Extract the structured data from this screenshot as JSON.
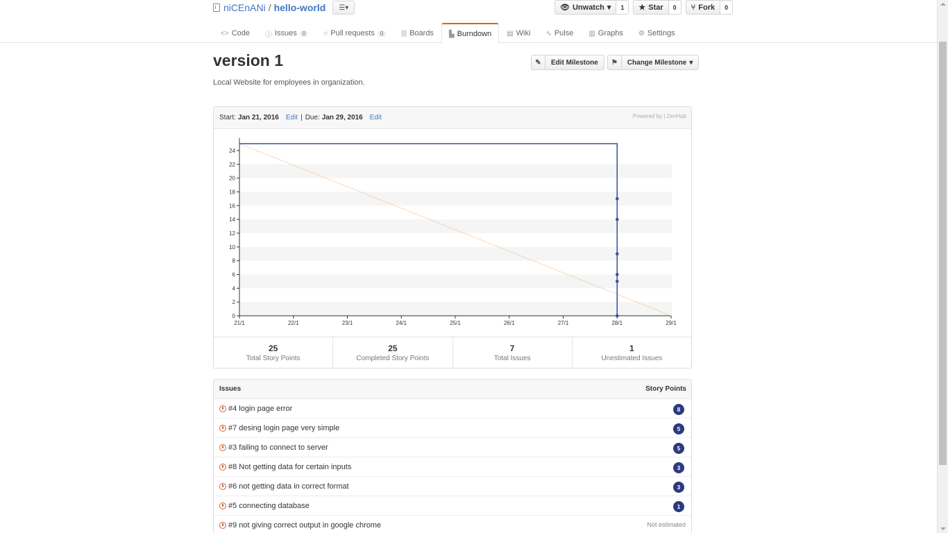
{
  "repo": {
    "owner": "niCEnANi",
    "separator": "/",
    "name": "hello-world",
    "menu_icon": "list-icon"
  },
  "actions": [
    {
      "label": "Unwatch",
      "icon": "eye-icon",
      "caret": true,
      "count": "1"
    },
    {
      "label": "Star",
      "icon": "star-icon",
      "caret": false,
      "count": "0"
    },
    {
      "label": "Fork",
      "icon": "fork-icon",
      "caret": false,
      "count": "0"
    }
  ],
  "tabs": [
    {
      "label": "Code",
      "icon": "code-icon",
      "count": null,
      "selected": false
    },
    {
      "label": "Issues",
      "icon": "issue-icon",
      "count": "0",
      "selected": false
    },
    {
      "label": "Pull requests",
      "icon": "pull-request-icon",
      "count": "0",
      "selected": false
    },
    {
      "label": "Boards",
      "icon": "boards-icon",
      "count": null,
      "selected": false
    },
    {
      "label": "Burndown",
      "icon": "burndown-icon",
      "count": null,
      "selected": true
    },
    {
      "label": "Wiki",
      "icon": "wiki-icon",
      "count": null,
      "selected": false
    },
    {
      "label": "Pulse",
      "icon": "pulse-icon",
      "count": null,
      "selected": false
    },
    {
      "label": "Graphs",
      "icon": "graph-icon",
      "count": null,
      "selected": false
    },
    {
      "label": "Settings",
      "icon": "gear-icon",
      "count": null,
      "selected": false
    }
  ],
  "milestone": {
    "title": "version 1",
    "description": "Local Website for employees in organization.",
    "edit_button": "Edit Milestone",
    "change_button": "Change Milestone",
    "start_label": "Start:",
    "start_date": "Jan 21, 2016",
    "due_label": "Due:",
    "due_date": "Jan 29, 2016",
    "edit_link": "Edit",
    "pipe": "|",
    "powered_by": "Powered by | ZenHub"
  },
  "chart_data": {
    "type": "line",
    "x_tick_labels": [
      "21/1",
      "22/1",
      "23/1",
      "24/1",
      "25/1",
      "26/1",
      "27/1",
      "28/1",
      "29/1"
    ],
    "y_ticks": [
      0,
      2,
      4,
      6,
      8,
      10,
      12,
      14,
      16,
      18,
      20,
      22,
      24
    ],
    "ylim": [
      0,
      25
    ],
    "xlim": [
      0,
      8
    ],
    "grid": "alternating horizontal bands",
    "series": [
      {
        "style": "ideal",
        "color": "#f0b27a",
        "x": [
          0,
          8
        ],
        "y": [
          25,
          0
        ]
      },
      {
        "style": "actual",
        "color": "#3a4d9e",
        "x": [
          0,
          7,
          7
        ],
        "y": [
          25,
          25,
          0
        ],
        "markers": [
          {
            "x": 7,
            "y": 17
          },
          {
            "x": 7,
            "y": 14
          },
          {
            "x": 7,
            "y": 9
          },
          {
            "x": 7,
            "y": 6
          },
          {
            "x": 7,
            "y": 5
          },
          {
            "x": 7,
            "y": 0
          }
        ]
      }
    ]
  },
  "stats": [
    {
      "value": "25",
      "label": "Total Story Points"
    },
    {
      "value": "25",
      "label": "Completed Story Points"
    },
    {
      "value": "7",
      "label": "Total Issues"
    },
    {
      "value": "1",
      "label": "Unestimated Issues"
    }
  ],
  "issues": {
    "header_left": "Issues",
    "header_right": "Story Points",
    "rows": [
      {
        "title": "#4 login page error",
        "points": "8"
      },
      {
        "title": "#7 desing login page very simple",
        "points": "5"
      },
      {
        "title": "#3 failing to connect to server",
        "points": "5"
      },
      {
        "title": "#8 Not getting data for certain inputs",
        "points": "3"
      },
      {
        "title": "#6 not getting data in correct format",
        "points": "3"
      },
      {
        "title": "#5 connecting database",
        "points": "1"
      },
      {
        "title": "#9 not giving correct output in google chrome",
        "points": null,
        "not_estimated": "Not estimated"
      }
    ]
  }
}
